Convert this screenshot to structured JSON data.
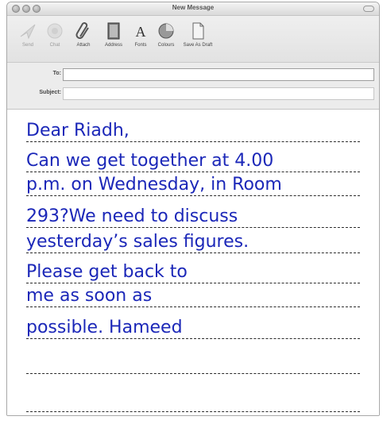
{
  "window": {
    "title": "New Message"
  },
  "toolbar": {
    "items": [
      {
        "label": "Send",
        "icon": "send-icon",
        "enabled": false
      },
      {
        "label": "Chat",
        "icon": "chat-icon",
        "enabled": false
      },
      {
        "label": "Attach",
        "icon": "paperclip-icon",
        "enabled": true
      },
      {
        "label": "Address",
        "icon": "address-book-icon",
        "enabled": true
      },
      {
        "label": "Fonts",
        "icon": "font-icon",
        "enabled": true
      },
      {
        "label": "Colours",
        "icon": "color-wheel-icon",
        "enabled": true
      },
      {
        "label": "Save As Draft",
        "icon": "draft-document-icon",
        "enabled": true
      }
    ]
  },
  "fields": {
    "to_label": "To:",
    "to_value": "",
    "subject_label": "Subject:",
    "subject_value": ""
  },
  "body": {
    "lines": [
      "Dear Riadh,",
      "Can we get together at 4.00",
      "p.m. on Wednesday, in Room",
      "293?We need to discuss",
      "yesterday’s sales figures.",
      "Please get back to",
      "me as soon as",
      "possible. Hameed",
      "",
      ""
    ]
  },
  "colors": {
    "handwriting": "#1b27b8",
    "chrome": "#ececec"
  }
}
